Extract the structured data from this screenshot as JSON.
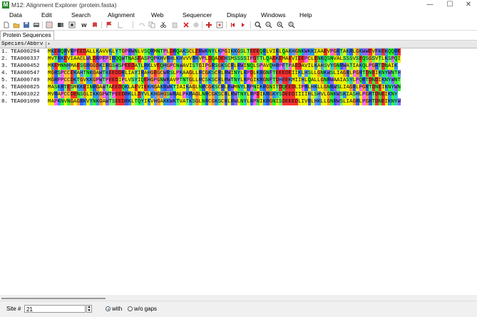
{
  "window": {
    "title": "M12: Alignment Explorer (protein.fasta)",
    "app_icon_letter": "M",
    "minimize_glyph": "—",
    "maximize_glyph": "☐",
    "close_glyph": "✕"
  },
  "menu": {
    "items": [
      "Data",
      "Edit",
      "Search",
      "Alignment",
      "Web",
      "Sequencer",
      "Display",
      "Windows",
      "Help"
    ]
  },
  "toolbar": {
    "icons": [
      "new-icon",
      "open-icon",
      "save-icon",
      "export-icon",
      "sequence-data-icon",
      "book-icon",
      "translate-icon",
      "align-icon",
      "font-icon",
      "flag-icon",
      "align-gap-icon",
      "undo-icon",
      "copy-icon",
      "cut-icon",
      "delete-icon",
      "paste-icon",
      "clear-icon",
      "add-row-icon",
      "insert-icon",
      "prev-icon",
      "next-icon",
      "search-icon",
      "find-prev-icon",
      "find-next-icon",
      "find-motif-icon"
    ]
  },
  "tab": {
    "label": "Protein Sequences"
  },
  "grid": {
    "header_label": "Species/Abbrv",
    "header_marker": "*",
    "rows": [
      {
        "num": "1.",
        "name": "TEA000294",
        "seq": "MKERQRVRPEEDALLKAVVKLYTGPRWNLVSQRMNTPLDRQAKSCLERWKNYLKPGIKKGSLTEEEQRLVIRLQAKHGNKWKKIAAEVPGRTAKRLGKWWEVFKEKQQRE"
      },
      {
        "num": "2.",
        "name": "TEA000337",
        "seq": "MVTRKEVIAACLWLDRPFPIRQQWTNASEASPQPKHVRHLKHVVVRKVPLDQADEHSMSSSSIPDTTLQAEKEMAEVIEEPCLENKQSNVALSSSVSEQSGSVTLKSPQI"
      },
      {
        "num": "3.",
        "name": "TEA000452",
        "seq": "MKEMNNHMAESGRGGDKIRGSWSPEEDATLRKLVEQHGPCNWAVISTGIPGRSGKSCRLRWINQLSPAVQHRPFTPAEDAVILKAHSVYGNRWATIAKQLPGRTDNAIK"
      },
      {
        "num": "4.",
        "name": "TEA000547",
        "seq": "MGRSPCCEKAHTNKGAWTKEEDDRLIAYIRAHGEGCWRSLPKAAGLLRCGKSCRLRWINYLRPDLKRGNFTEEEDEIIKLHSLLGNKWSLIAGRLPGRTDNEIKNYWNTH"
      },
      {
        "num": "5.",
        "name": "TEA000749",
        "seq": "MGRPPCCDKTGVKKGPWTPEEDIPLVSYIQEHGPGNWRAVPTNTGLLRCSKSCRLRWTNYLRPGIKRGNFTDHEEKMIIHLQALLGNRWAAIASYLPQRTDNDIKNYWNT"
      },
      {
        "num": "6.",
        "name": "TEA000825",
        "seq": "MASKRTESMKKEINRGAWTAEEDQKLAEVIEKHGAKRWKTIAIKAGLNRCGKSCRLRWMNYLRPNIKRGNITDQEEDLIPRLHKLLGNRWSLIAGRLPGRTDNEIKNYWN"
      },
      {
        "num": "7.",
        "name": "TEA001022",
        "seq": "MVRAPCCDENSGLIKKGPWTPEEDRKLLDYVLKHGHGSWRALPKRAGLNRCGKSCRLRWTNYLRPDIKRGKYSDEEDIIIIHLSHVLGNKWSKIASHLPGRTDNEIKNY"
      },
      {
        "num": "8.",
        "name": "TEA001090",
        "seq": "MAPKNVNGAGRKVYNKGAWTSEEDRKLTQYIKVHGAKKWKTVATKSGLNRCGKSCRLRWLNYLRPNIKRGNISDEEEDLIVRLHKLLGNRWSLIAGRLPGRTDNEIKNYW"
      }
    ]
  },
  "status": {
    "site_label": "Site #",
    "site_value": "21",
    "with_label": "with",
    "without_label": "w/o gaps",
    "selected": "with"
  },
  "residue_colors": {
    "A": "#f0f000",
    "V": "#f0f000",
    "L": "#f0f000",
    "I": "#f0f000",
    "M": "#f0f000",
    "F": "#9966ff",
    "W": "#9966ff",
    "Y": "#33cccc",
    "G": "#ff9933",
    "P": "#ff66ff",
    "S": "#66ff66",
    "T": "#66ff66",
    "C": "#ffcc33",
    "N": "#33ff33",
    "Q": "#33ff33",
    "H": "#6699ff",
    "D": "#ff3333",
    "E": "#ff3333",
    "K": "#3399ff",
    "R": "#3366ff"
  }
}
